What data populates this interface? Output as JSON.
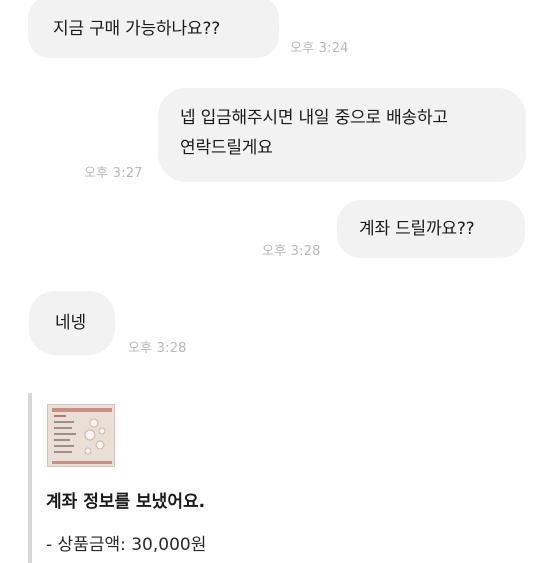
{
  "messages": [
    {
      "side": "incoming",
      "lines": [
        "지금 구매 가능하나요??"
      ],
      "time": "오후 3:24"
    },
    {
      "side": "outgoing",
      "lines": [
        "넵 입금해주시면 내일 중으로 배송하고",
        "연락드릴게요"
      ],
      "time": "오후 3:27"
    },
    {
      "side": "outgoing",
      "lines": [
        "계좌 드릴까요??"
      ],
      "time": "오후 3:28"
    },
    {
      "side": "incoming",
      "lines": [
        "네넹"
      ],
      "time": "오후 3:28"
    }
  ],
  "payment_card": {
    "thumbnail_icon": "product-photo",
    "title": "계좌 정보를 보냈어요.",
    "price_label": "- 상품금액: 30,000원"
  },
  "colors": {
    "bubble_bg": "#f2f2f2",
    "timestamp": "#b9b9b9",
    "text": "#1a1a1a",
    "card_bar": "#d8d8d8"
  }
}
